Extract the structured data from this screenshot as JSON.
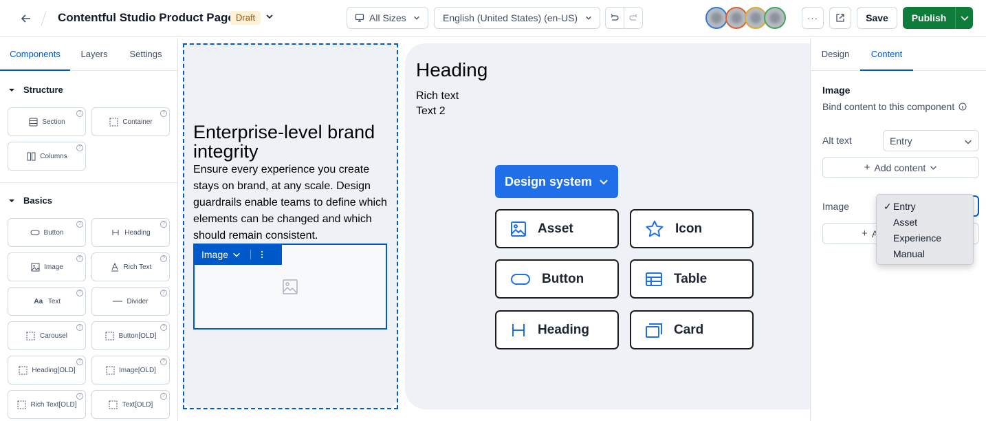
{
  "topbar": {
    "title": "Contentful Studio Product Page",
    "status_badge": "Draft",
    "breakpoint_select": "All Sizes",
    "locale_select": "English (United States) (en-US)",
    "more_label": "···",
    "save_label": "Save",
    "publish_label": "Publish",
    "avatars": [
      {
        "ring": "#2f7bd6"
      },
      {
        "ring": "#e0602d"
      },
      {
        "ring": "#e0a92d"
      },
      {
        "ring": "#47a55a"
      }
    ]
  },
  "left_panel": {
    "tabs": [
      "Components",
      "Layers",
      "Settings"
    ],
    "active_tab": "Components",
    "sections": [
      {
        "title": "Structure",
        "items": [
          "Section",
          "Container",
          "Columns"
        ]
      },
      {
        "title": "Basics",
        "items": [
          "Button",
          "Heading",
          "Image",
          "Rich Text",
          "Text",
          "Divider",
          "Carousel",
          "Button[OLD]",
          "Heading[OLD]",
          "Image[OLD]",
          "Rich Text[OLD]",
          "Text[OLD]"
        ]
      }
    ]
  },
  "canvas": {
    "hero": {
      "heading": "Enterprise-level brand integrity",
      "body": "Ensure every experience you create stays on brand, at any scale. Design guardrails enable teams to define which elements can be changed and which should remain consistent.",
      "image_component_label": "Image"
    },
    "card2": {
      "heading": "Heading",
      "rich_text": "Rich text",
      "text2": "Text 2",
      "design_system_button": "Design system",
      "pills": [
        {
          "label": "Asset",
          "icon": "image-icon"
        },
        {
          "label": "Icon",
          "icon": "star-icon"
        },
        {
          "label": "Button",
          "icon": "button-icon"
        },
        {
          "label": "Table",
          "icon": "table-icon"
        },
        {
          "label": "Heading",
          "icon": "heading-icon"
        },
        {
          "label": "Card",
          "icon": "card-icon"
        }
      ]
    }
  },
  "right_panel": {
    "tabs": [
      "Design",
      "Content"
    ],
    "active_tab": "Content",
    "title": "Image",
    "subtitle": "Bind content to this component",
    "alt_text_label": "Alt text",
    "alt_text_value": "Entry",
    "add_content_label": "Add content",
    "image_label": "Image",
    "image_add_partial": "A",
    "dropdown_options": [
      "Entry",
      "Asset",
      "Experience",
      "Manual"
    ],
    "dropdown_selected": "Entry"
  },
  "colors": {
    "accent": "#0059c8",
    "publish": "#0e7c3a",
    "draft_bg": "#fdf1d6",
    "design_system_blue": "#1f6fe8"
  }
}
